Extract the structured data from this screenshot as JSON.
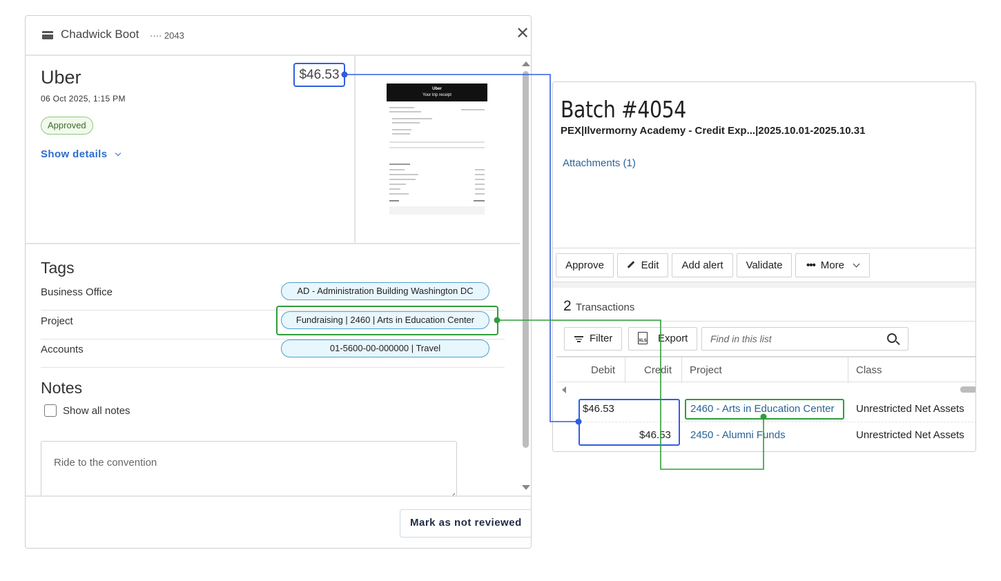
{
  "expense_panel": {
    "cardholder_name": "Chadwick Boot",
    "card_last4": "···· 2043",
    "close_label": "✕",
    "merchant": "Uber",
    "datetime": "06 Oct 2025, 1:15 PM",
    "status": "Approved",
    "show_details_label": "Show details",
    "amount": "$46.53",
    "receipt": {
      "header_title": "Uber",
      "header_subtitle": "Your trip receipt"
    },
    "tags_heading": "Tags",
    "tags": [
      {
        "label": "Business Office",
        "value": "AD - Administration Building Washington DC"
      },
      {
        "label": "Project",
        "value": "Fundraising | 2460 | Arts in Education Center"
      },
      {
        "label": "Accounts",
        "value": "01-5600-00-000000 | Travel"
      }
    ],
    "notes_heading": "Notes",
    "show_all_notes_label": "Show all notes",
    "note_text": "Ride to the convention",
    "mark_not_reviewed_label": "Mark as not reviewed"
  },
  "batch_panel": {
    "title": "Batch #4054",
    "subtitle": "PEX|Ilvermorny Academy - Credit Exp...|2025.10.01-2025.10.31",
    "attachments_label": "Attachments (1)",
    "actions": {
      "approve": "Approve",
      "edit": "Edit",
      "add_alert": "Add alert",
      "validate": "Validate",
      "more": "More"
    },
    "transaction_count": "2",
    "transactions_label": "Transactions",
    "filter_label": "Filter",
    "export_label": "Export",
    "xls_label": "XLS",
    "search_placeholder": "Find in this list",
    "columns": {
      "debit": "Debit",
      "credit": "Credit",
      "project": "Project",
      "class": "Class"
    },
    "rows": [
      {
        "debit": "$46.53",
        "credit": "",
        "project": "2460 - Arts in Education Center",
        "class": "Unrestricted Net Assets"
      },
      {
        "debit": "",
        "credit": "$46.53",
        "project": "2450 - Alumni Funds",
        "class": "Unrestricted Net Assets"
      }
    ]
  },
  "colors": {
    "amount_highlight": "#2f5ee0",
    "project_highlight": "#2e9d3a",
    "link": "#2a6496",
    "approved_badge": "#8dc97a"
  }
}
